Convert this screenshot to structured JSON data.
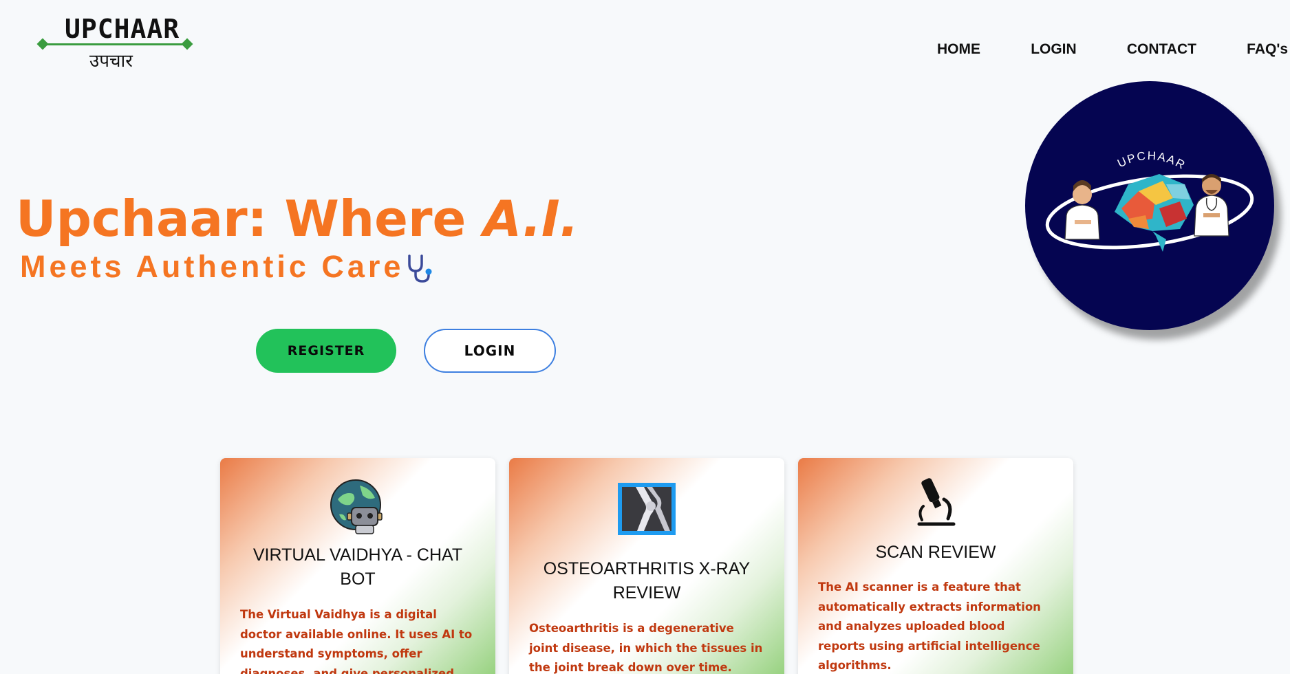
{
  "logo": {
    "english": "UPCHAAR",
    "hindi": "उपचार",
    "accent": "#3a9c3f"
  },
  "nav": {
    "items": [
      "HOME",
      "LOGIN",
      "CONTACT",
      "FAQ's"
    ]
  },
  "hero": {
    "title_main": "Upchaar: Where ",
    "title_emphasis": "A.I.",
    "subtitle": "Meets Authentic Care",
    "register_label": "REGISTER",
    "login_label": "LOGIN",
    "title_color": "#f57522"
  },
  "badge": {
    "text": "UPCHAAR",
    "background": "#050551"
  },
  "cards": [
    {
      "title": "VIRTUAL VAIDHYA - CHAT BOT",
      "text": "The Virtual Vaidhya is a digital doctor available online. It uses AI to understand symptoms, offer diagnoses, and give personalized advice through text.",
      "icon": "robot-globe-icon"
    },
    {
      "title": "OSTEOARTHRITIS X-RAY REVIEW",
      "text": "Osteoarthritis is a degenerative joint disease, in which the tissues in the joint break down over time. Scan your X-Ray",
      "icon": "knee-xray-icon"
    },
    {
      "title": "SCAN REVIEW",
      "text": "The AI scanner is a feature that automatically extracts information and analyzes uploaded blood reports using artificial intelligence algorithms.",
      "icon": "microscope-icon"
    }
  ]
}
